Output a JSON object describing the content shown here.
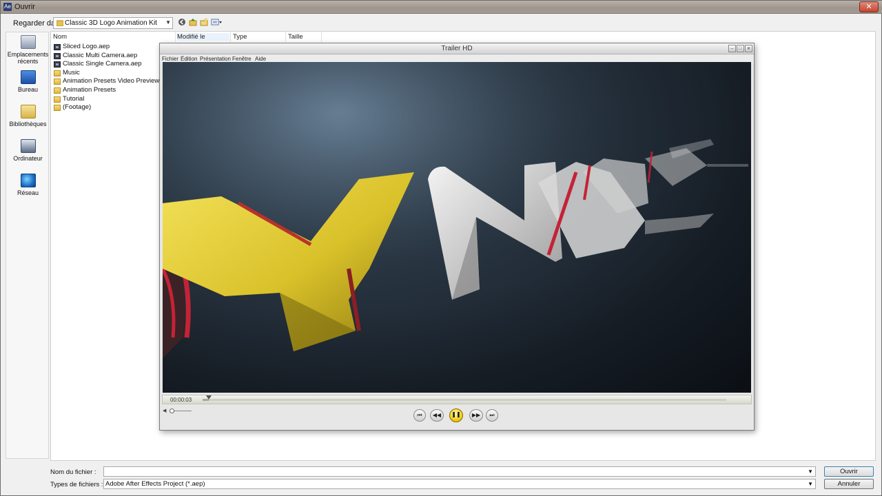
{
  "dialog": {
    "title": "Ouvrir",
    "close_glyph": "✕",
    "lookin_label": "Regarder dans :",
    "lookin_value": "Classic 3D Logo Animation Kit",
    "places": [
      {
        "label": "Emplacements récents",
        "icon": "recent-places-icon"
      },
      {
        "label": "Bureau",
        "icon": "desktop-icon"
      },
      {
        "label": "Bibliothèques",
        "icon": "libraries-icon"
      },
      {
        "label": "Ordinateur",
        "icon": "computer-icon"
      },
      {
        "label": "Réseau",
        "icon": "network-icon"
      }
    ],
    "columns": [
      "Nom",
      "Modifié le",
      "Type",
      "Taille"
    ],
    "files": [
      {
        "name": "Sliced Logo.aep",
        "kind": "aep"
      },
      {
        "name": "Classic Multi Camera.aep",
        "kind": "aep"
      },
      {
        "name": "Classic Single Camera.aep",
        "kind": "aep"
      },
      {
        "name": "Music",
        "kind": "folder"
      },
      {
        "name": "Animation Presets Video Previews",
        "kind": "folder"
      },
      {
        "name": "Animation Presets",
        "kind": "folder"
      },
      {
        "name": "Tutorial",
        "kind": "folder"
      },
      {
        "name": "(Footage)",
        "kind": "folder"
      }
    ],
    "filename_label": "Nom du fichier :",
    "filename_value": "",
    "filetype_label": "Types de fichiers :",
    "filetype_value": "Adobe After Effects Project (*.aep)",
    "open_button": "Ouvrir",
    "cancel_button": "Annuler"
  },
  "player": {
    "title": "Trailer HD",
    "menus": [
      "Fichier",
      "Édition",
      "Présentation",
      "Fenêtre",
      "Aide"
    ],
    "timecode": "00:00:03",
    "progress_fraction": 0.012,
    "volume_fraction": 0.1,
    "state": "playing",
    "accent_color": "#f0cf1a"
  }
}
